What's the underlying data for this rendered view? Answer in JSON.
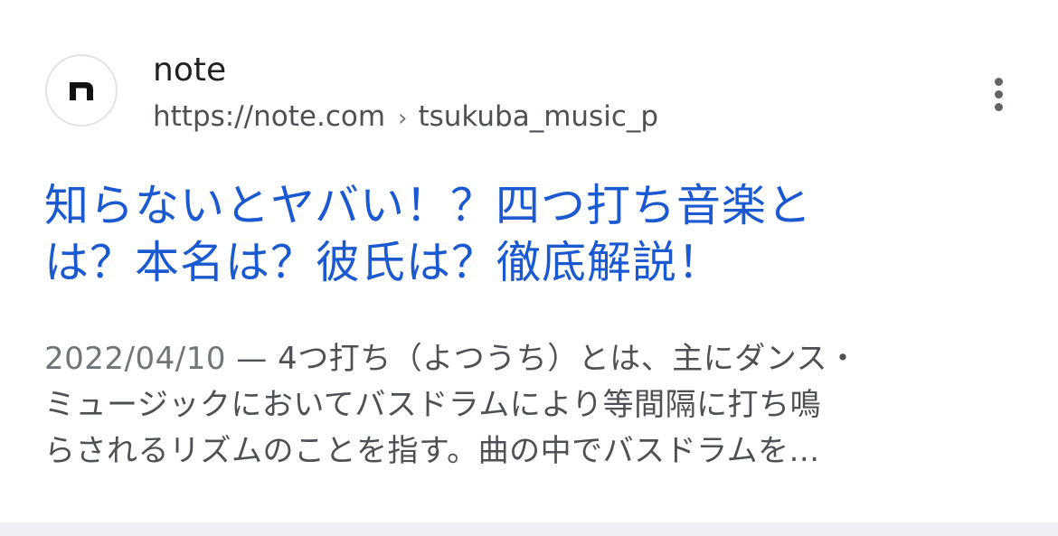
{
  "result": {
    "site_name": "note",
    "url": {
      "domain": "https://note.com",
      "separator": "›",
      "path": "tsukuba_music_p"
    },
    "favicon": {
      "icon": "note-logo-icon",
      "letter": "n"
    },
    "more_icon": "more-vert-icon",
    "title_line1": "知らないとヤバい！？四つ打ち音楽と",
    "title_line2": "は？本名は？彼氏は？徹底解説！",
    "snippet": {
      "date": "2022/04/10",
      "dash": " — ",
      "line1": "4つ打ち（よつうち）とは、主にダンス・",
      "line2": "ミュージックにおいてバスドラムにより等間隔に打ち鳴",
      "line3": "らされるリズムのことを指す。曲の中でバスドラムを..."
    }
  },
  "colors": {
    "title": "#1a59d0",
    "text": "#4d5156",
    "site_name": "#202124",
    "divider": "#eef0f3"
  }
}
